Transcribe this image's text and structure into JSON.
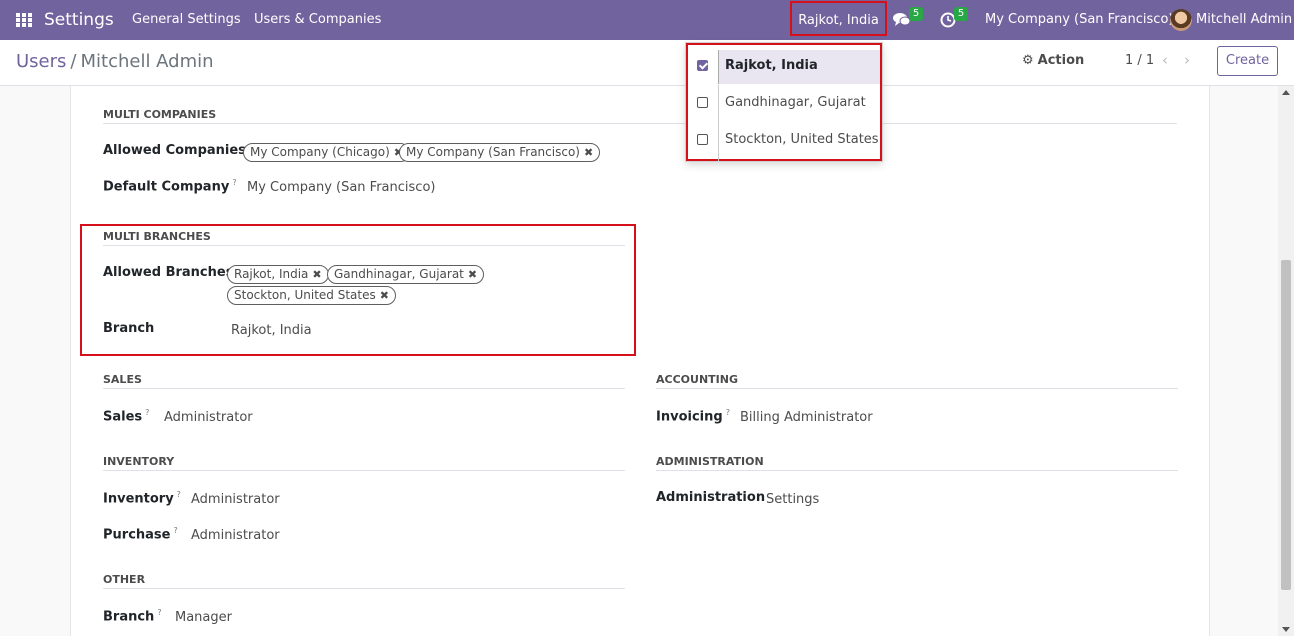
{
  "navbar": {
    "app_title": "Settings",
    "menu": [
      "General Settings",
      "Users & Companies"
    ],
    "current_branch": "Rajkot, India",
    "messages_count": "5",
    "activities_count": "5",
    "company": "My Company (San Francisco)",
    "user": "Mitchell Admin",
    "icons": [
      "apps-grid-icon",
      "chat-icon",
      "clock-icon",
      "avatar"
    ]
  },
  "breadcrumb": {
    "parent": "Users",
    "separator": "/",
    "current": "Mitchell Admin"
  },
  "control": {
    "action_label": "Action",
    "pager": "1 / 1",
    "prev": "‹",
    "next": "›",
    "create_label": "Create"
  },
  "branch_dropdown": {
    "items": [
      {
        "label": "Rajkot, India",
        "checked": true
      },
      {
        "label": "Gandhinagar, Gujarat",
        "checked": false
      },
      {
        "label": "Stockton, United States",
        "checked": false
      }
    ]
  },
  "form": {
    "multi_companies": {
      "title": "MULTI COMPANIES",
      "allowed_label": "Allowed Companies",
      "allowed": [
        "My Company (Chicago)",
        "My Company (San Francisco)"
      ],
      "default_label": "Default Company",
      "default_value": "My Company (San Francisco)"
    },
    "multi_branches": {
      "title": "MULTI BRANCHES",
      "allowed_label": "Allowed Branches",
      "allowed": [
        "Rajkot, India",
        "Gandhinagar, Gujarat",
        "Stockton, United States"
      ],
      "branch_label": "Branch",
      "branch_value": "Rajkot, India"
    },
    "sales": {
      "title": "SALES",
      "label": "Sales",
      "value": "Administrator"
    },
    "accounting": {
      "title": "ACCOUNTING",
      "label": "Invoicing",
      "value": "Billing Administrator"
    },
    "inventory": {
      "title": "INVENTORY",
      "inventory_label": "Inventory",
      "inventory_value": "Administrator",
      "purchase_label": "Purchase",
      "purchase_value": "Administrator"
    },
    "administration": {
      "title": "ADMINISTRATION",
      "label": "Administration",
      "value": "Settings"
    },
    "other": {
      "title": "OTHER",
      "label": "Branch",
      "value": "Manager"
    },
    "help_mark": "?",
    "remove_mark": "✖"
  },
  "colors": {
    "brand": "#71639e",
    "highlight": "#d6101b",
    "badge": "#28a745"
  }
}
